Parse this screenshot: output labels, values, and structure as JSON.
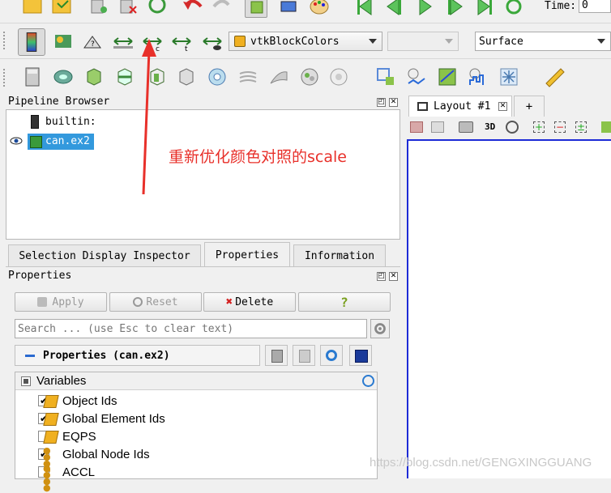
{
  "toolbar_top": {
    "time_label": "Time:",
    "time_value": "0"
  },
  "toolbar_second": {
    "color_array": "vtkBlockColors",
    "component": "",
    "representation": "Surface"
  },
  "pipeline_browser": {
    "title": "Pipeline Browser",
    "items": [
      {
        "label": "builtin:"
      },
      {
        "label": "can.ex2"
      }
    ]
  },
  "annotation": {
    "text": "重新优化颜色对照的scale",
    "color": "#e8302a"
  },
  "layout": {
    "tab_label": "Layout #1",
    "add_tab": "+",
    "view_3d_label": "3D",
    "view_border_color": "#1d2bd6"
  },
  "lower_tabs": [
    {
      "label": "Selection Display Inspector"
    },
    {
      "label": "Properties"
    },
    {
      "label": "Information"
    }
  ],
  "properties_panel": {
    "title": "Properties",
    "apply_label": "Apply",
    "reset_label": "Reset",
    "delete_label": "Delete",
    "help_label": "?",
    "search_placeholder": "Search ... (use Esc to clear text)",
    "section_title": "Properties (can.ex2)",
    "variables_header": "Variables",
    "variables": [
      {
        "label": "Object Ids",
        "checked": true,
        "icon": "cell-data-icon"
      },
      {
        "label": "Global Element Ids",
        "checked": true,
        "icon": "cell-data-icon"
      },
      {
        "label": "EQPS",
        "checked": false,
        "icon": "cell-data-icon"
      },
      {
        "label": "Global Node Ids",
        "checked": true,
        "icon": "point-data-icon"
      },
      {
        "label": "ACCL",
        "checked": false,
        "icon": "point-data-icon"
      }
    ]
  },
  "watermark": "https://blog.csdn.net/GENGXINGGUANG",
  "colors": {
    "selection_bg": "#3399dd",
    "accent_blue": "#1d2bd6"
  }
}
